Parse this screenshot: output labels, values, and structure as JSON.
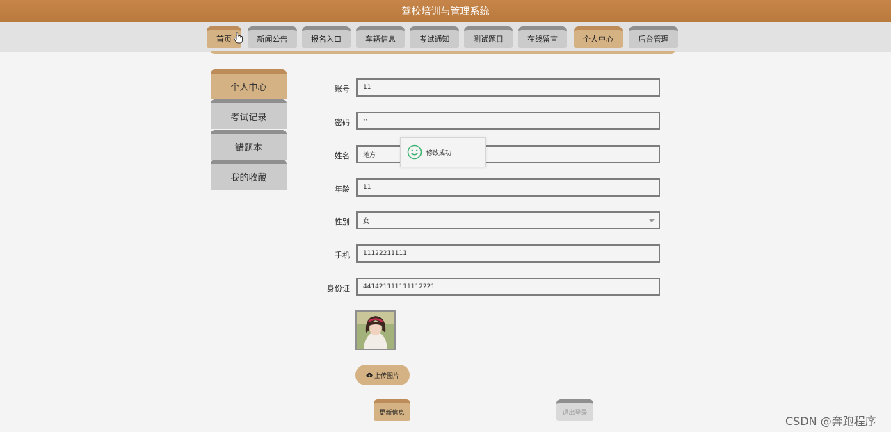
{
  "app": {
    "title": "驾校培训与管理系统"
  },
  "nav": {
    "items": [
      {
        "label": "首页"
      },
      {
        "label": "新闻公告"
      },
      {
        "label": "报名入口"
      },
      {
        "label": "车辆信息"
      },
      {
        "label": "考试通知"
      },
      {
        "label": "测试题目"
      },
      {
        "label": "在线留言"
      },
      {
        "label": "个人中心"
      },
      {
        "label": "后台管理"
      }
    ],
    "active": "个人中心"
  },
  "sidebar": {
    "items": [
      {
        "label": "个人中心"
      },
      {
        "label": "考试记录"
      },
      {
        "label": "错题本"
      },
      {
        "label": "我的收藏"
      }
    ],
    "active": "个人中心"
  },
  "form": {
    "account": {
      "label": "账号",
      "value": "11"
    },
    "password": {
      "label": "密码",
      "value": "··"
    },
    "name": {
      "label": "姓名",
      "value": "地方"
    },
    "age": {
      "label": "年龄",
      "value": "11"
    },
    "gender": {
      "label": "性别",
      "value": "女"
    },
    "phone": {
      "label": "手机",
      "value": "11122211111"
    },
    "id_card": {
      "label": "身份证",
      "value": "441421111111112221"
    }
  },
  "upload": {
    "label": "上传图片",
    "icon": "cloud-upload-icon"
  },
  "actions": {
    "update_label": "更新信息",
    "logout_label": "退出登录"
  },
  "toast": {
    "message": "修改成功",
    "icon": "smile-icon"
  },
  "watermark": {
    "text": "CSDN @奔跑程序"
  },
  "colors": {
    "header": "#b97a3d",
    "accent": "#d5b283",
    "inactive": "#cbcbcb"
  }
}
